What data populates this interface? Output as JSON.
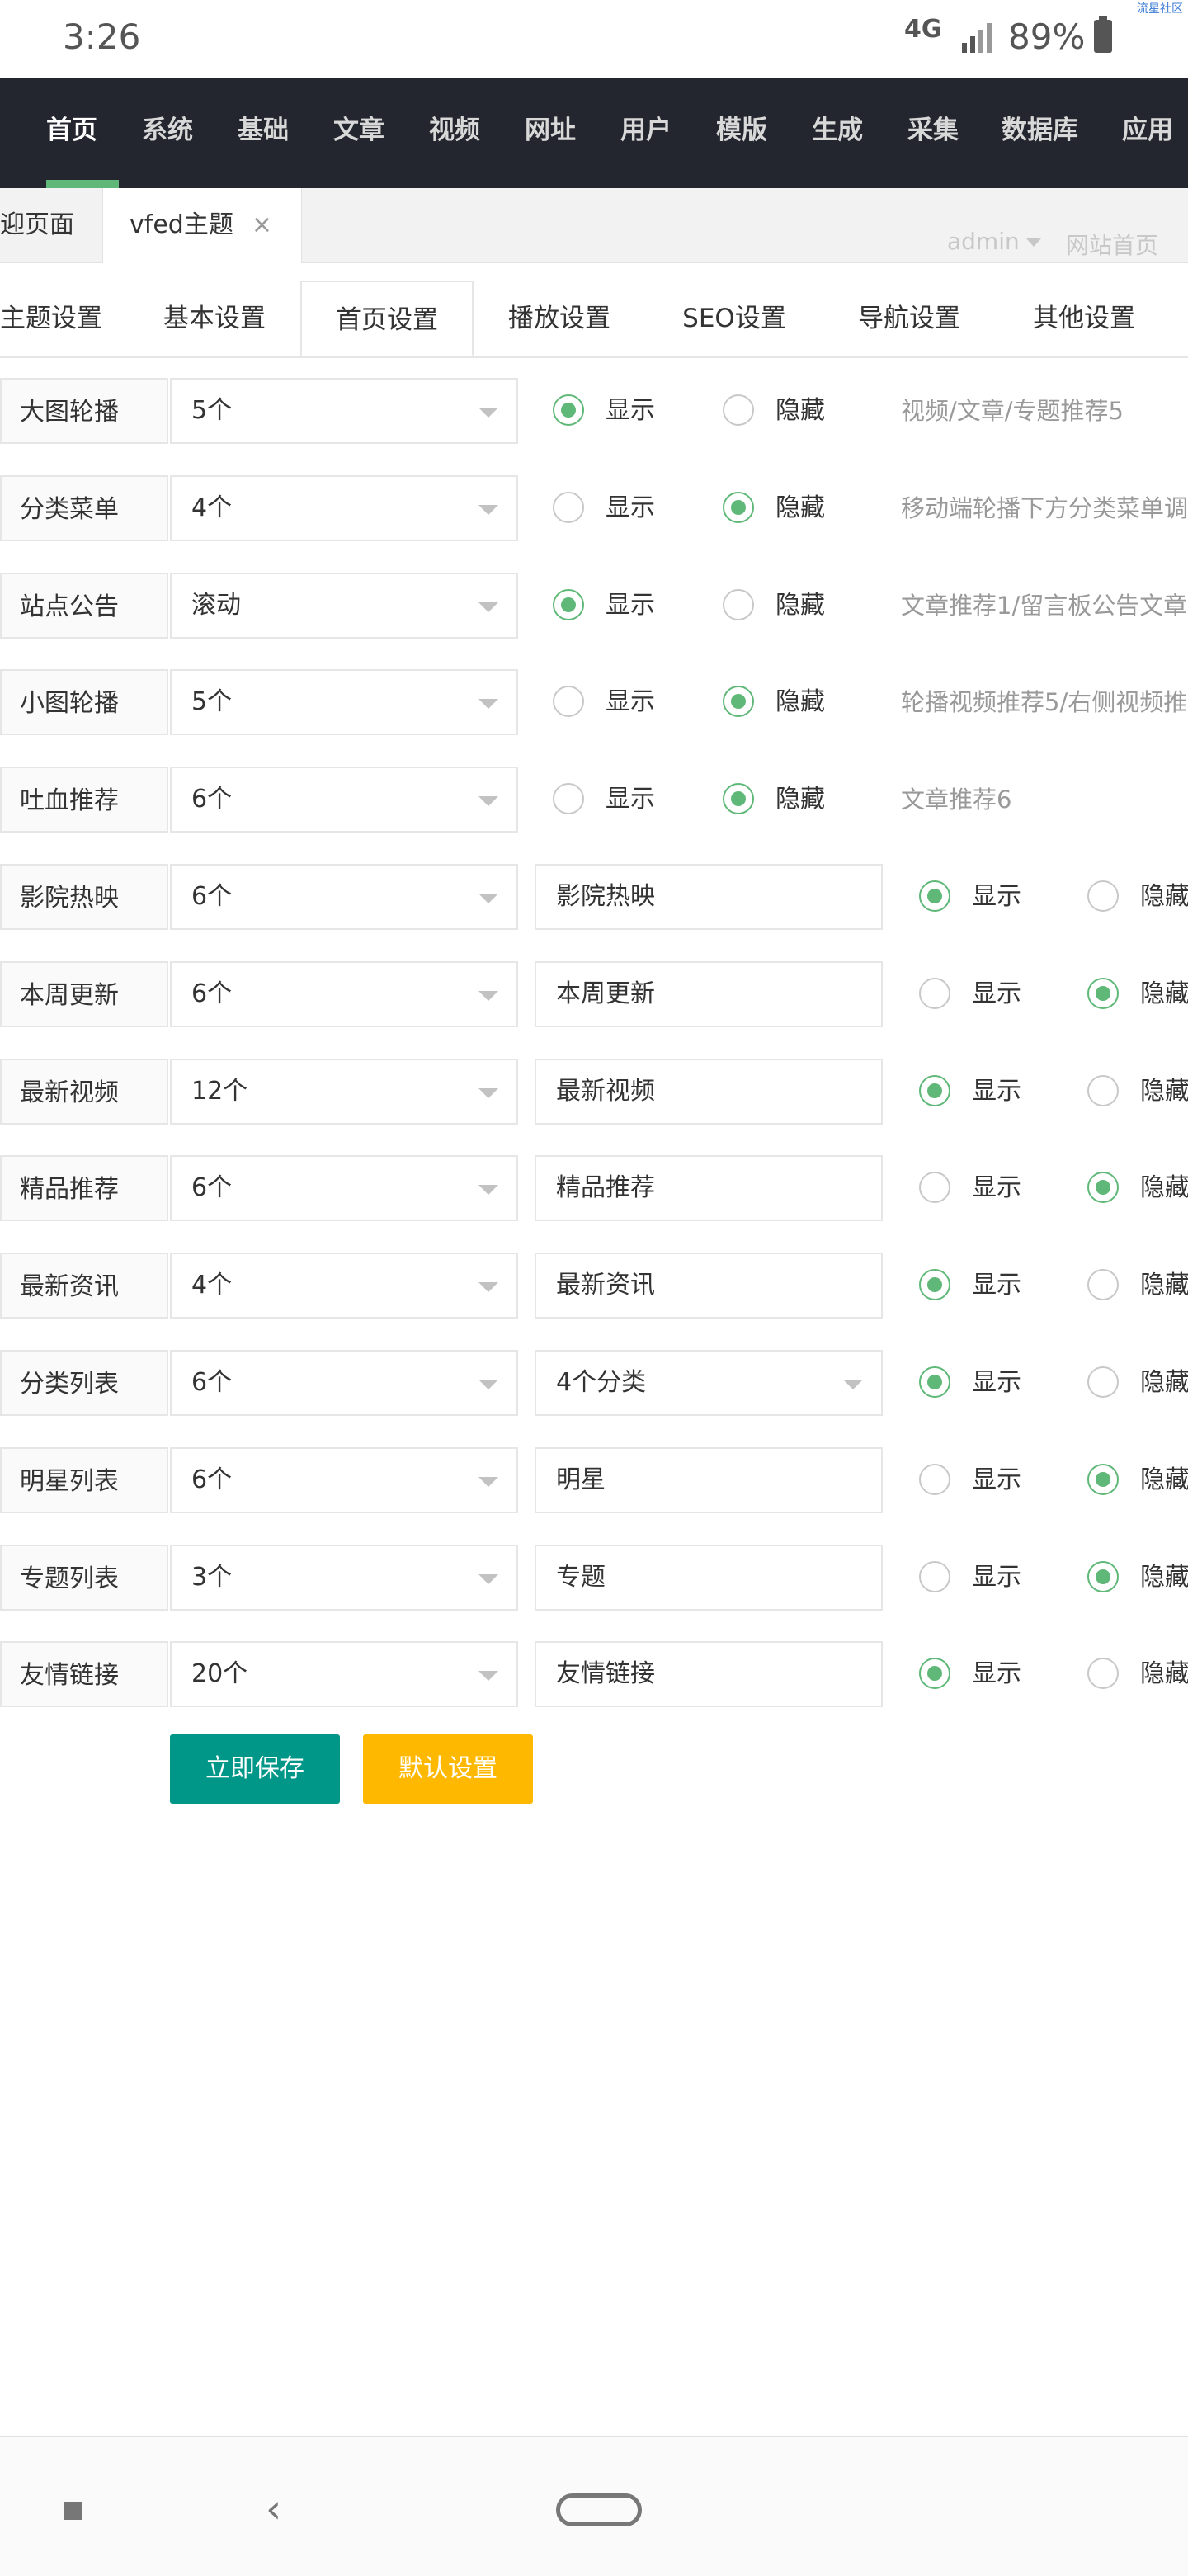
{
  "status_bar": {
    "time": "3:26",
    "network": "4G",
    "battery": "89%",
    "watermark": "流星社区"
  },
  "top_nav": {
    "items": [
      "首页",
      "系统",
      "基础",
      "文章",
      "视频",
      "网址",
      "用户",
      "模版",
      "生成",
      "采集",
      "数据库",
      "应用"
    ],
    "active_index": 0,
    "accent_color": "#5fb878",
    "background_color": "#23262e"
  },
  "tab_bar": {
    "tabs": [
      "迎页面",
      "vfed主题"
    ],
    "active_index": 1,
    "close_glyph": "×",
    "user": "admin",
    "site_link": "网站首页"
  },
  "sub_tabs": {
    "items": [
      "主题设置",
      "基本设置",
      "首页设置",
      "播放设置",
      "SEO设置",
      "导航设置",
      "其他设置"
    ],
    "active_index": 2
  },
  "radio_options": {
    "show": "显示",
    "hide": "隐藏"
  },
  "short_rows": [
    {
      "label": "大图轮播",
      "count": "5个",
      "visible": true,
      "hint": "视频/文章/专题推荐5"
    },
    {
      "label": "分类菜单",
      "count": "4个",
      "visible": false,
      "hint": "移动端轮播下方分类菜单调"
    },
    {
      "label": "站点公告",
      "count": "滚动",
      "visible": true,
      "hint": "文章推荐1/留言板公告文章"
    },
    {
      "label": "小图轮播",
      "count": "5个",
      "visible": false,
      "hint": "轮播视频推荐5/右侧视频推"
    },
    {
      "label": "吐血推荐",
      "count": "6个",
      "visible": false,
      "hint": "文章推荐6"
    }
  ],
  "long_rows": [
    {
      "label": "影院热映",
      "count": "6个",
      "title": "影院热映",
      "title_is_select": false,
      "visible": true
    },
    {
      "label": "本周更新",
      "count": "6个",
      "title": "本周更新",
      "title_is_select": false,
      "visible": false
    },
    {
      "label": "最新视频",
      "count": "12个",
      "title": "最新视频",
      "title_is_select": false,
      "visible": true
    },
    {
      "label": "精品推荐",
      "count": "6个",
      "title": "精品推荐",
      "title_is_select": false,
      "visible": false
    },
    {
      "label": "最新资讯",
      "count": "4个",
      "title": "最新资讯",
      "title_is_select": false,
      "visible": true
    },
    {
      "label": "分类列表",
      "count": "6个",
      "title": "4个分类",
      "title_is_select": true,
      "visible": true
    },
    {
      "label": "明星列表",
      "count": "6个",
      "title": "明星",
      "title_is_select": false,
      "visible": false
    },
    {
      "label": "专题列表",
      "count": "3个",
      "title": "专题",
      "title_is_select": false,
      "visible": false
    },
    {
      "label": "友情链接",
      "count": "20个",
      "title": "友情链接",
      "title_is_select": false,
      "visible": true
    }
  ],
  "buttons": {
    "save": "立即保存",
    "default": "默认设置",
    "save_color": "#009688",
    "default_color": "#ffb800"
  }
}
